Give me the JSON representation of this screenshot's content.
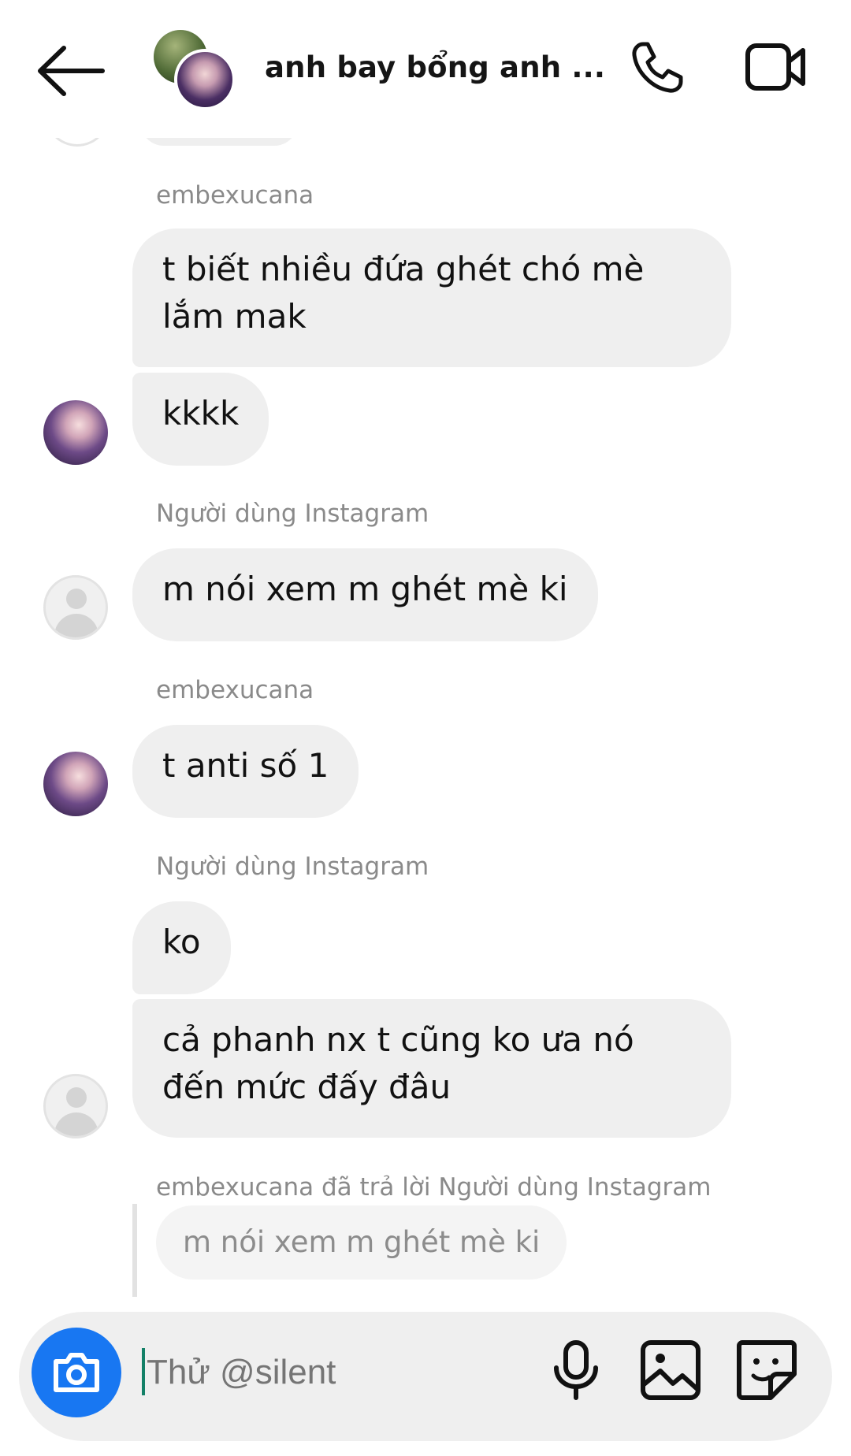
{
  "header": {
    "title": "anh bay bổng anh ...",
    "icons": {
      "back": "back-arrow-icon",
      "call": "phone-icon",
      "video": "video-camera-icon"
    }
  },
  "messages": [
    {
      "sender": "embexucana",
      "bubbles": [
        "t biết nhiều đứa ghét chó mè lắm mak",
        "kkkk"
      ],
      "avatar": "photo"
    },
    {
      "sender": "Người dùng Instagram",
      "bubbles": [
        "m nói xem m ghét mè ki"
      ],
      "avatar": "blank"
    },
    {
      "sender": "embexucana",
      "bubbles": [
        "t anti số 1"
      ],
      "avatar": "photo"
    },
    {
      "sender": "Người dùng Instagram",
      "bubbles": [
        "ko",
        "cả phanh nx t cũng ko ưa nó đến mức đấy đâu"
      ],
      "avatar": "blank"
    }
  ],
  "reply": {
    "label": "embexucana đã trả lời Người dùng Instagram",
    "quoted": "m nói xem m ghét mè ki"
  },
  "composer": {
    "placeholder": "Thử @silent",
    "icons": [
      "camera-icon",
      "microphone-icon",
      "gallery-icon",
      "sticker-icon"
    ],
    "camera_color": "#1877f2"
  }
}
